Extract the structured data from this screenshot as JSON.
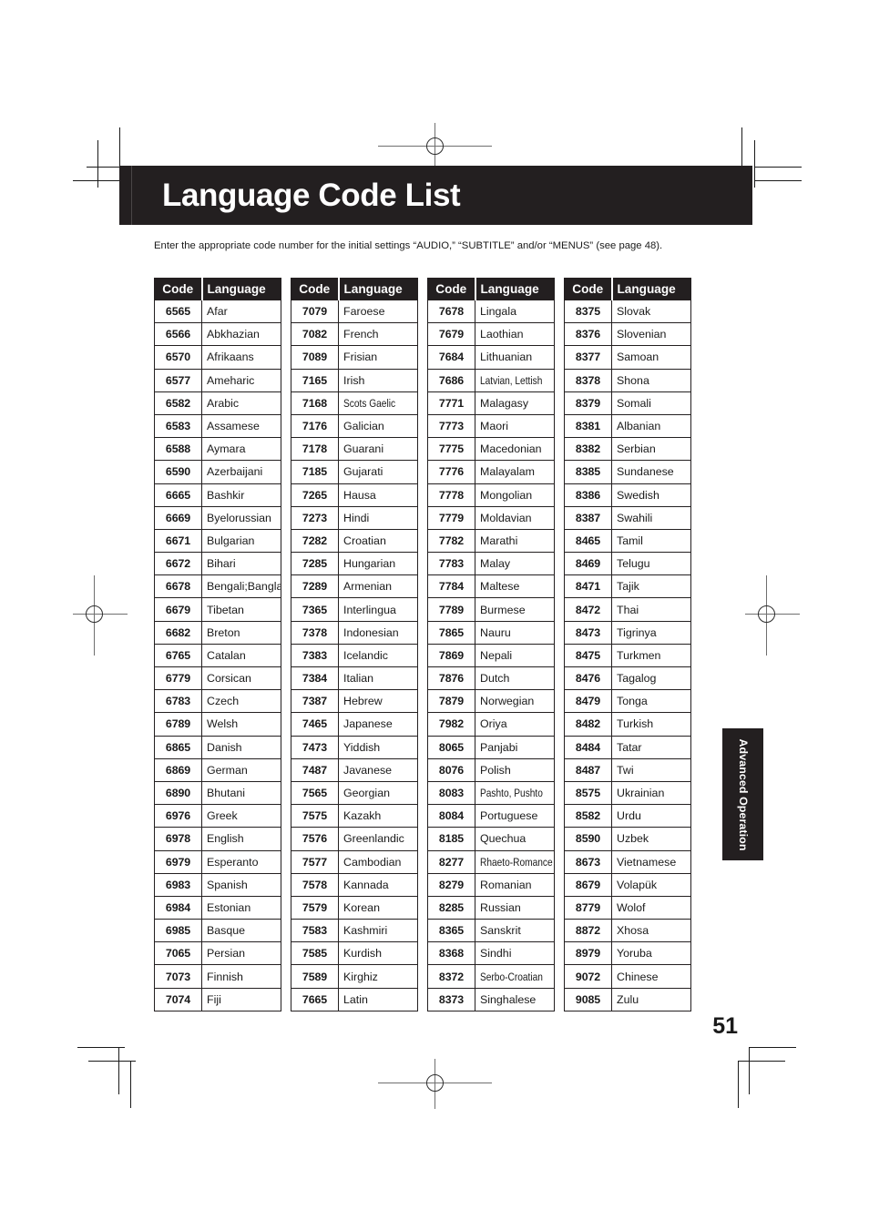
{
  "page": {
    "title": "Language Code List",
    "intro": "Enter the appropriate code number for the initial settings “AUDIO,” “SUBTITLE” and/or “MENUS” (see page 48).",
    "number": "51",
    "side_tab": "Advanced Operation",
    "band_color": "#231f20",
    "background_color": "#ffffff",
    "text_color": "#1a1a1a"
  },
  "table": {
    "headers": {
      "code": "Code",
      "language": "Language"
    },
    "columns": [
      {
        "rows": [
          {
            "code": "6565",
            "language": "Afar"
          },
          {
            "code": "6566",
            "language": "Abkhazian"
          },
          {
            "code": "6570",
            "language": "Afrikaans"
          },
          {
            "code": "6577",
            "language": "Ameharic"
          },
          {
            "code": "6582",
            "language": "Arabic"
          },
          {
            "code": "6583",
            "language": "Assamese"
          },
          {
            "code": "6588",
            "language": "Aymara"
          },
          {
            "code": "6590",
            "language": "Azerbaijani"
          },
          {
            "code": "6665",
            "language": "Bashkir"
          },
          {
            "code": "6669",
            "language": "Byelorussian"
          },
          {
            "code": "6671",
            "language": "Bulgarian"
          },
          {
            "code": "6672",
            "language": "Bihari"
          },
          {
            "code": "6678",
            "language": "Bengali;Bangla"
          },
          {
            "code": "6679",
            "language": "Tibetan"
          },
          {
            "code": "6682",
            "language": "Breton"
          },
          {
            "code": "6765",
            "language": "Catalan"
          },
          {
            "code": "6779",
            "language": "Corsican"
          },
          {
            "code": "6783",
            "language": "Czech"
          },
          {
            "code": "6789",
            "language": "Welsh"
          },
          {
            "code": "6865",
            "language": "Danish"
          },
          {
            "code": "6869",
            "language": "German"
          },
          {
            "code": "6890",
            "language": "Bhutani"
          },
          {
            "code": "6976",
            "language": "Greek"
          },
          {
            "code": "6978",
            "language": "English"
          },
          {
            "code": "6979",
            "language": "Esperanto"
          },
          {
            "code": "6983",
            "language": "Spanish"
          },
          {
            "code": "6984",
            "language": "Estonian"
          },
          {
            "code": "6985",
            "language": "Basque"
          },
          {
            "code": "7065",
            "language": "Persian"
          },
          {
            "code": "7073",
            "language": "Finnish"
          },
          {
            "code": "7074",
            "language": "Fiji"
          }
        ]
      },
      {
        "rows": [
          {
            "code": "7079",
            "language": "Faroese"
          },
          {
            "code": "7082",
            "language": "French"
          },
          {
            "code": "7089",
            "language": "Frisian"
          },
          {
            "code": "7165",
            "language": "Irish"
          },
          {
            "code": "7168",
            "language": "Scots Gaelic",
            "squeeze": true
          },
          {
            "code": "7176",
            "language": "Galician"
          },
          {
            "code": "7178",
            "language": "Guarani"
          },
          {
            "code": "7185",
            "language": "Gujarati"
          },
          {
            "code": "7265",
            "language": "Hausa"
          },
          {
            "code": "7273",
            "language": "Hindi"
          },
          {
            "code": "7282",
            "language": "Croatian"
          },
          {
            "code": "7285",
            "language": "Hungarian"
          },
          {
            "code": "7289",
            "language": "Armenian"
          },
          {
            "code": "7365",
            "language": "Interlingua"
          },
          {
            "code": "7378",
            "language": "Indonesian"
          },
          {
            "code": "7383",
            "language": "Icelandic"
          },
          {
            "code": "7384",
            "language": "Italian"
          },
          {
            "code": "7387",
            "language": "Hebrew"
          },
          {
            "code": "7465",
            "language": "Japanese"
          },
          {
            "code": "7473",
            "language": "Yiddish"
          },
          {
            "code": "7487",
            "language": "Javanese"
          },
          {
            "code": "7565",
            "language": "Georgian"
          },
          {
            "code": "7575",
            "language": "Kazakh"
          },
          {
            "code": "7576",
            "language": "Greenlandic"
          },
          {
            "code": "7577",
            "language": "Cambodian"
          },
          {
            "code": "7578",
            "language": "Kannada"
          },
          {
            "code": "7579",
            "language": "Korean"
          },
          {
            "code": "7583",
            "language": "Kashmiri"
          },
          {
            "code": "7585",
            "language": "Kurdish"
          },
          {
            "code": "7589",
            "language": "Kirghiz"
          },
          {
            "code": "7665",
            "language": "Latin"
          }
        ]
      },
      {
        "rows": [
          {
            "code": "7678",
            "language": "Lingala"
          },
          {
            "code": "7679",
            "language": "Laothian"
          },
          {
            "code": "7684",
            "language": "Lithuanian"
          },
          {
            "code": "7686",
            "language": "Latvian, Lettish",
            "squeeze": true
          },
          {
            "code": "7771",
            "language": "Malagasy"
          },
          {
            "code": "7773",
            "language": "Maori"
          },
          {
            "code": "7775",
            "language": "Macedonian"
          },
          {
            "code": "7776",
            "language": "Malayalam"
          },
          {
            "code": "7778",
            "language": "Mongolian"
          },
          {
            "code": "7779",
            "language": "Moldavian"
          },
          {
            "code": "7782",
            "language": "Marathi"
          },
          {
            "code": "7783",
            "language": "Malay"
          },
          {
            "code": "7784",
            "language": "Maltese"
          },
          {
            "code": "7789",
            "language": "Burmese"
          },
          {
            "code": "7865",
            "language": "Nauru"
          },
          {
            "code": "7869",
            "language": "Nepali"
          },
          {
            "code": "7876",
            "language": "Dutch"
          },
          {
            "code": "7879",
            "language": "Norwegian"
          },
          {
            "code": "7982",
            "language": "Oriya"
          },
          {
            "code": "8065",
            "language": "Panjabi"
          },
          {
            "code": "8076",
            "language": "Polish"
          },
          {
            "code": "8083",
            "language": "Pashto, Pushto",
            "squeeze": true
          },
          {
            "code": "8084",
            "language": "Portuguese"
          },
          {
            "code": "8185",
            "language": "Quechua"
          },
          {
            "code": "8277",
            "language": "Rhaeto-Romance",
            "squeeze": true
          },
          {
            "code": "8279",
            "language": "Romanian"
          },
          {
            "code": "8285",
            "language": "Russian"
          },
          {
            "code": "8365",
            "language": "Sanskrit"
          },
          {
            "code": "8368",
            "language": "Sindhi"
          },
          {
            "code": "8372",
            "language": "Serbo-Croatian",
            "squeeze": true
          },
          {
            "code": "8373",
            "language": "Singhalese"
          }
        ]
      },
      {
        "rows": [
          {
            "code": "8375",
            "language": "Slovak"
          },
          {
            "code": "8376",
            "language": "Slovenian"
          },
          {
            "code": "8377",
            "language": "Samoan"
          },
          {
            "code": "8378",
            "language": "Shona"
          },
          {
            "code": "8379",
            "language": "Somali"
          },
          {
            "code": "8381",
            "language": "Albanian"
          },
          {
            "code": "8382",
            "language": "Serbian"
          },
          {
            "code": "8385",
            "language": "Sundanese"
          },
          {
            "code": "8386",
            "language": "Swedish"
          },
          {
            "code": "8387",
            "language": "Swahili"
          },
          {
            "code": "8465",
            "language": "Tamil"
          },
          {
            "code": "8469",
            "language": "Telugu"
          },
          {
            "code": "8471",
            "language": "Tajik"
          },
          {
            "code": "8472",
            "language": "Thai"
          },
          {
            "code": "8473",
            "language": "Tigrinya"
          },
          {
            "code": "8475",
            "language": "Turkmen"
          },
          {
            "code": "8476",
            "language": "Tagalog"
          },
          {
            "code": "8479",
            "language": "Tonga"
          },
          {
            "code": "8482",
            "language": "Turkish"
          },
          {
            "code": "8484",
            "language": "Tatar"
          },
          {
            "code": "8487",
            "language": "Twi"
          },
          {
            "code": "8575",
            "language": "Ukrainian"
          },
          {
            "code": "8582",
            "language": "Urdu"
          },
          {
            "code": "8590",
            "language": "Uzbek"
          },
          {
            "code": "8673",
            "language": "Vietnamese"
          },
          {
            "code": "8679",
            "language": "Volapük"
          },
          {
            "code": "8779",
            "language": "Wolof"
          },
          {
            "code": "8872",
            "language": "Xhosa"
          },
          {
            "code": "8979",
            "language": "Yoruba"
          },
          {
            "code": "9072",
            "language": "Chinese"
          },
          {
            "code": "9085",
            "language": "Zulu"
          }
        ]
      }
    ]
  }
}
